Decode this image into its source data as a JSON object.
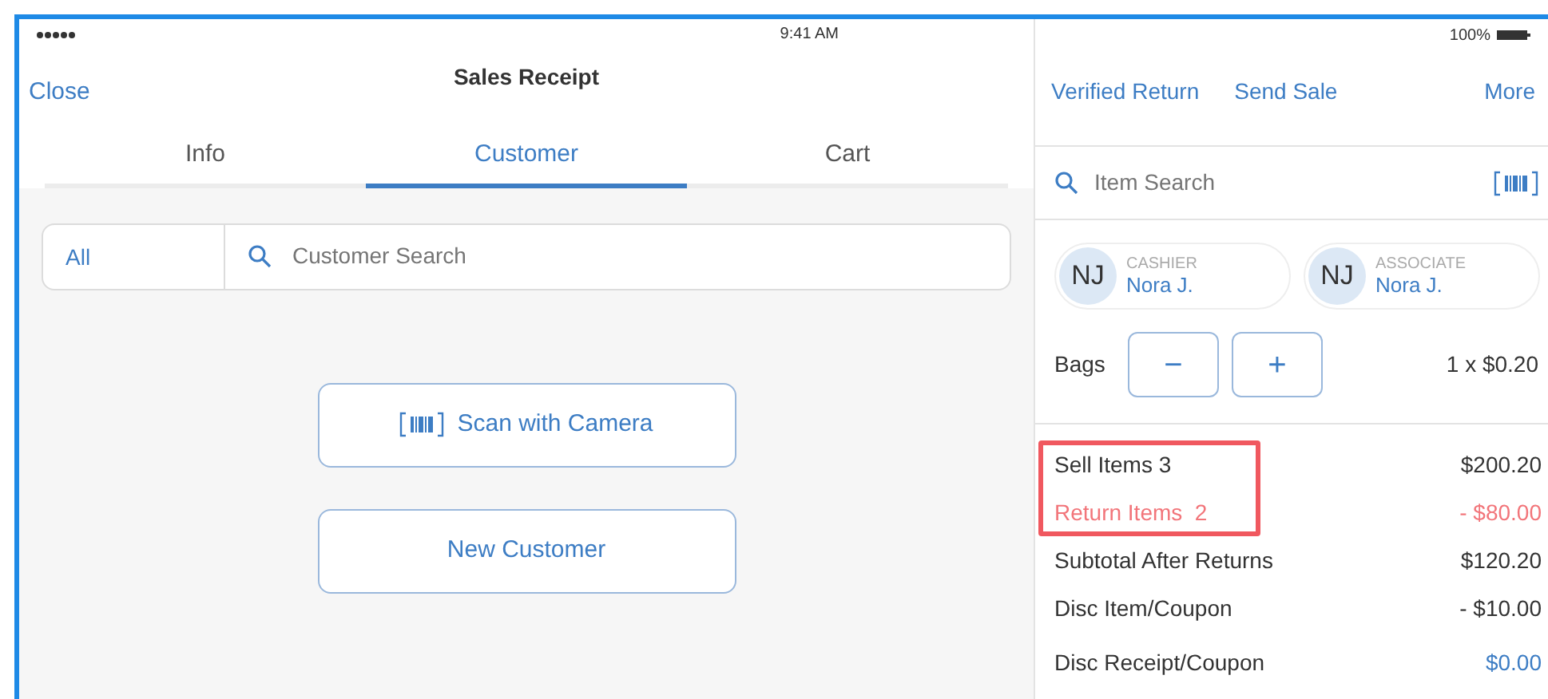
{
  "status_bar": {
    "time": "9:41 AM",
    "battery": "100%"
  },
  "header": {
    "close": "Close",
    "title": "Sales Receipt"
  },
  "tabs": [
    {
      "label": "Info",
      "selected": false
    },
    {
      "label": "Customer",
      "selected": true
    },
    {
      "label": "Cart",
      "selected": false
    }
  ],
  "customer_search": {
    "filter": "All",
    "placeholder": "Customer Search"
  },
  "buttons": [
    "Scan with Camera",
    "New Customer"
  ],
  "actions": [
    "Verified Return",
    "Send Sale",
    "More"
  ],
  "item_search": {
    "placeholder": "Item Search"
  },
  "staff": [
    {
      "initials": "NJ",
      "role": "CASHIER",
      "name": "Nora J."
    },
    {
      "initials": "NJ",
      "role": "ASSOCIATE",
      "name": "Nora J."
    }
  ],
  "bags": {
    "label": "Bags",
    "minus": "−",
    "plus": "+",
    "value": "1 x $0.20"
  },
  "summary": [
    {
      "label": "Sell Items 3",
      "value": "$200.20",
      "kind": "normal",
      "highlighted": true
    },
    {
      "label": "Return Items  2",
      "value": "- $80.00",
      "kind": "return",
      "highlighted": true
    },
    {
      "label": "Subtotal After Returns",
      "value": "$120.20",
      "kind": "normal",
      "highlighted": false
    },
    {
      "label": "Disc Item/Coupon",
      "value": "- $10.00",
      "kind": "normal",
      "highlighted": false
    },
    {
      "label": "Disc Receipt/Coupon",
      "value": "$0.00",
      "kind": "link",
      "highlighted": false
    }
  ]
}
